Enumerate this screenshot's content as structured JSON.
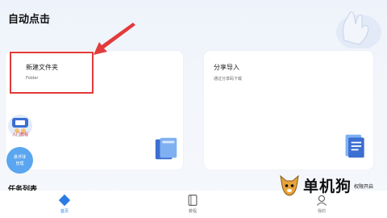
{
  "app": {
    "title": "自动点击"
  },
  "cards": [
    {
      "title": "新建文件夹",
      "subtitle": "Folder"
    },
    {
      "title": "分享导入",
      "subtitle": "通过分享码下载"
    }
  ],
  "floating": {
    "tutorial_label": "入门教程",
    "ball_label_line1": "悬浮球",
    "ball_label_line2": "管理"
  },
  "section": {
    "task_list_title": "任务列表"
  },
  "bottom_nav": [
    {
      "label": "首页",
      "icon": "home-icon",
      "active": true
    },
    {
      "label": "教程",
      "icon": "book-icon",
      "active": false
    },
    {
      "label": "我的",
      "icon": "user-icon",
      "active": false
    }
  ],
  "watermark": {
    "brand": "单机狗",
    "partial_text": "权限开启"
  },
  "colors": {
    "accent": "#2c7be5",
    "highlight": "#e23b3b",
    "float_ball": "#5aa6f0"
  }
}
